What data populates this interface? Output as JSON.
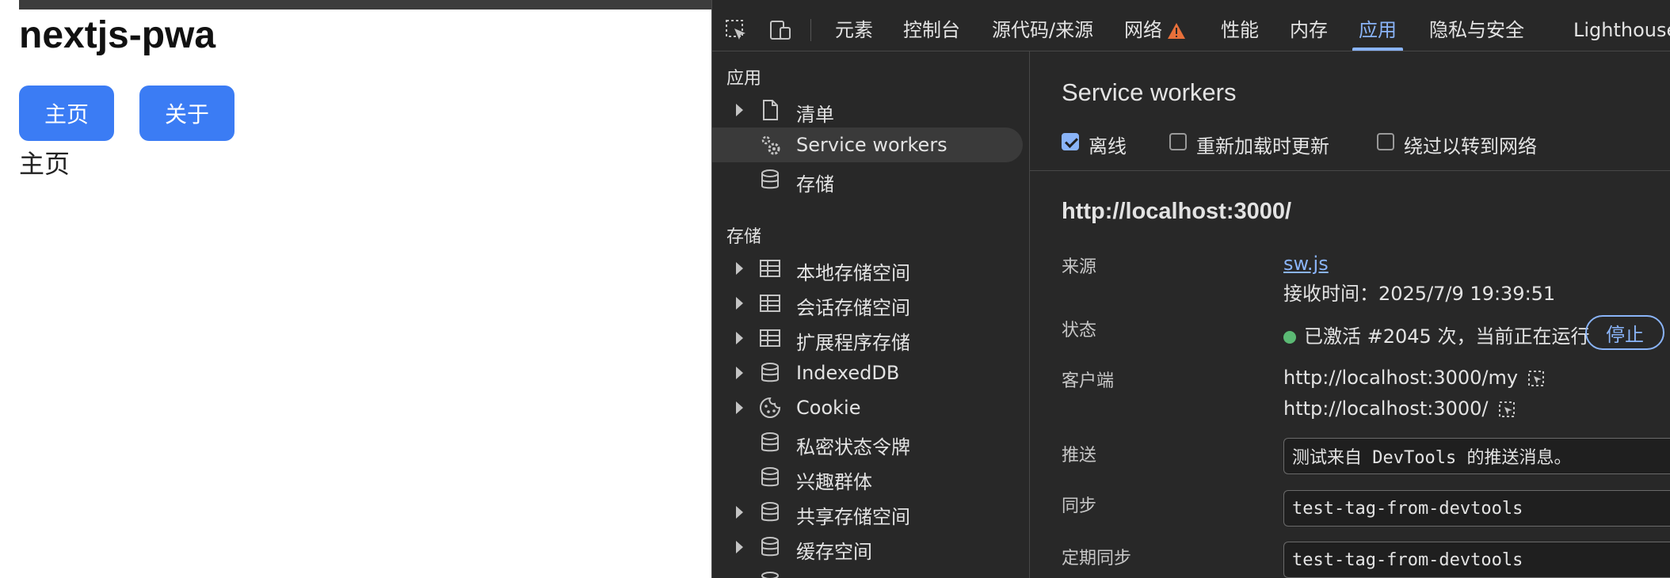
{
  "page": {
    "title": "nextjs-pwa",
    "nav": {
      "home_label": "主页",
      "about_label": "关于"
    },
    "content_text": "主页"
  },
  "devtools": {
    "tabs": [
      {
        "label": "元素",
        "active": false
      },
      {
        "label": "控制台",
        "active": false
      },
      {
        "label": "源代码/来源",
        "active": false
      },
      {
        "label": "网络",
        "active": false,
        "warning": true
      },
      {
        "label": "性能",
        "active": false
      },
      {
        "label": "内存",
        "active": false
      },
      {
        "label": "应用",
        "active": true
      },
      {
        "label": "隐私与安全",
        "active": false
      },
      {
        "label": "Lighthouse",
        "active": false
      }
    ],
    "sidebar": {
      "section_app": "应用",
      "app_items": [
        {
          "label": "清单",
          "icon": "file-icon",
          "expandable": true
        },
        {
          "label": "Service workers",
          "icon": "gears-icon",
          "expandable": false,
          "selected": true
        },
        {
          "label": "存储",
          "icon": "database-icon",
          "expandable": false
        }
      ],
      "section_storage": "存储",
      "storage_items": [
        {
          "label": "本地存储空间",
          "icon": "table-icon",
          "expandable": true
        },
        {
          "label": "会话存储空间",
          "icon": "table-icon",
          "expandable": true
        },
        {
          "label": "扩展程序存储",
          "icon": "table-icon",
          "expandable": true
        },
        {
          "label": "IndexedDB",
          "icon": "database-icon",
          "expandable": true
        },
        {
          "label": "Cookie",
          "icon": "cookie-icon",
          "expandable": true
        },
        {
          "label": "私密状态令牌",
          "icon": "database-icon",
          "expandable": false
        },
        {
          "label": "兴趣群体",
          "icon": "database-icon",
          "expandable": false
        },
        {
          "label": "共享存储空间",
          "icon": "database-icon",
          "expandable": true
        },
        {
          "label": "缓存空间",
          "icon": "database-icon",
          "expandable": true
        }
      ]
    },
    "main": {
      "title": "Service workers",
      "options": [
        {
          "label": "离线",
          "checked": true
        },
        {
          "label": "重新加载时更新",
          "checked": false
        },
        {
          "label": "绕过以转到网络",
          "checked": false
        }
      ],
      "origin": "http://localhost:3000/",
      "source_label": "来源",
      "source_link": "sw.js",
      "received_time": "接收时间：2025/7/9 19:39:51",
      "status_label": "状态",
      "status_text": "已激活 #2045 次，当前正在运行",
      "stop_label": "停止",
      "clients_label": "客户端",
      "clients": [
        "http://localhost:3000/my",
        "http://localhost:3000/"
      ],
      "push_label": "推送",
      "push_value": "测试来自 DevTools 的推送消息。",
      "sync_label": "同步",
      "sync_value": "test-tag-from-devtools",
      "periodic_sync_label": "定期同步",
      "periodic_sync_value": "test-tag-from-devtools"
    }
  }
}
